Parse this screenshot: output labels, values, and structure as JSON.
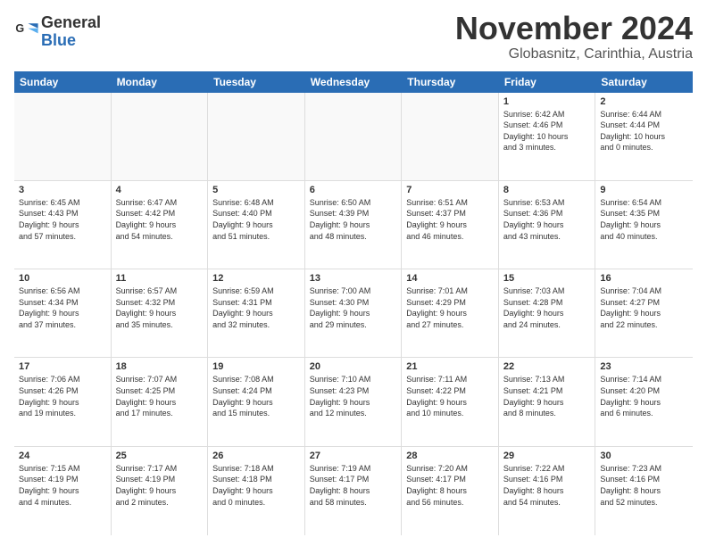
{
  "logo": {
    "text_general": "General",
    "text_blue": "Blue"
  },
  "title": {
    "month": "November 2024",
    "location": "Globasnitz, Carinthia, Austria"
  },
  "header_days": [
    "Sunday",
    "Monday",
    "Tuesday",
    "Wednesday",
    "Thursday",
    "Friday",
    "Saturday"
  ],
  "weeks": [
    [
      {
        "day": "",
        "info": "",
        "empty": true
      },
      {
        "day": "",
        "info": "",
        "empty": true
      },
      {
        "day": "",
        "info": "",
        "empty": true
      },
      {
        "day": "",
        "info": "",
        "empty": true
      },
      {
        "day": "",
        "info": "",
        "empty": true
      },
      {
        "day": "1",
        "info": "Sunrise: 6:42 AM\nSunset: 4:46 PM\nDaylight: 10 hours\nand 3 minutes."
      },
      {
        "day": "2",
        "info": "Sunrise: 6:44 AM\nSunset: 4:44 PM\nDaylight: 10 hours\nand 0 minutes."
      }
    ],
    [
      {
        "day": "3",
        "info": "Sunrise: 6:45 AM\nSunset: 4:43 PM\nDaylight: 9 hours\nand 57 minutes."
      },
      {
        "day": "4",
        "info": "Sunrise: 6:47 AM\nSunset: 4:42 PM\nDaylight: 9 hours\nand 54 minutes."
      },
      {
        "day": "5",
        "info": "Sunrise: 6:48 AM\nSunset: 4:40 PM\nDaylight: 9 hours\nand 51 minutes."
      },
      {
        "day": "6",
        "info": "Sunrise: 6:50 AM\nSunset: 4:39 PM\nDaylight: 9 hours\nand 48 minutes."
      },
      {
        "day": "7",
        "info": "Sunrise: 6:51 AM\nSunset: 4:37 PM\nDaylight: 9 hours\nand 46 minutes."
      },
      {
        "day": "8",
        "info": "Sunrise: 6:53 AM\nSunset: 4:36 PM\nDaylight: 9 hours\nand 43 minutes."
      },
      {
        "day": "9",
        "info": "Sunrise: 6:54 AM\nSunset: 4:35 PM\nDaylight: 9 hours\nand 40 minutes."
      }
    ],
    [
      {
        "day": "10",
        "info": "Sunrise: 6:56 AM\nSunset: 4:34 PM\nDaylight: 9 hours\nand 37 minutes."
      },
      {
        "day": "11",
        "info": "Sunrise: 6:57 AM\nSunset: 4:32 PM\nDaylight: 9 hours\nand 35 minutes."
      },
      {
        "day": "12",
        "info": "Sunrise: 6:59 AM\nSunset: 4:31 PM\nDaylight: 9 hours\nand 32 minutes."
      },
      {
        "day": "13",
        "info": "Sunrise: 7:00 AM\nSunset: 4:30 PM\nDaylight: 9 hours\nand 29 minutes."
      },
      {
        "day": "14",
        "info": "Sunrise: 7:01 AM\nSunset: 4:29 PM\nDaylight: 9 hours\nand 27 minutes."
      },
      {
        "day": "15",
        "info": "Sunrise: 7:03 AM\nSunset: 4:28 PM\nDaylight: 9 hours\nand 24 minutes."
      },
      {
        "day": "16",
        "info": "Sunrise: 7:04 AM\nSunset: 4:27 PM\nDaylight: 9 hours\nand 22 minutes."
      }
    ],
    [
      {
        "day": "17",
        "info": "Sunrise: 7:06 AM\nSunset: 4:26 PM\nDaylight: 9 hours\nand 19 minutes."
      },
      {
        "day": "18",
        "info": "Sunrise: 7:07 AM\nSunset: 4:25 PM\nDaylight: 9 hours\nand 17 minutes."
      },
      {
        "day": "19",
        "info": "Sunrise: 7:08 AM\nSunset: 4:24 PM\nDaylight: 9 hours\nand 15 minutes."
      },
      {
        "day": "20",
        "info": "Sunrise: 7:10 AM\nSunset: 4:23 PM\nDaylight: 9 hours\nand 12 minutes."
      },
      {
        "day": "21",
        "info": "Sunrise: 7:11 AM\nSunset: 4:22 PM\nDaylight: 9 hours\nand 10 minutes."
      },
      {
        "day": "22",
        "info": "Sunrise: 7:13 AM\nSunset: 4:21 PM\nDaylight: 9 hours\nand 8 minutes."
      },
      {
        "day": "23",
        "info": "Sunrise: 7:14 AM\nSunset: 4:20 PM\nDaylight: 9 hours\nand 6 minutes."
      }
    ],
    [
      {
        "day": "24",
        "info": "Sunrise: 7:15 AM\nSunset: 4:19 PM\nDaylight: 9 hours\nand 4 minutes."
      },
      {
        "day": "25",
        "info": "Sunrise: 7:17 AM\nSunset: 4:19 PM\nDaylight: 9 hours\nand 2 minutes."
      },
      {
        "day": "26",
        "info": "Sunrise: 7:18 AM\nSunset: 4:18 PM\nDaylight: 9 hours\nand 0 minutes."
      },
      {
        "day": "27",
        "info": "Sunrise: 7:19 AM\nSunset: 4:17 PM\nDaylight: 8 hours\nand 58 minutes."
      },
      {
        "day": "28",
        "info": "Sunrise: 7:20 AM\nSunset: 4:17 PM\nDaylight: 8 hours\nand 56 minutes."
      },
      {
        "day": "29",
        "info": "Sunrise: 7:22 AM\nSunset: 4:16 PM\nDaylight: 8 hours\nand 54 minutes."
      },
      {
        "day": "30",
        "info": "Sunrise: 7:23 AM\nSunset: 4:16 PM\nDaylight: 8 hours\nand 52 minutes."
      }
    ]
  ]
}
